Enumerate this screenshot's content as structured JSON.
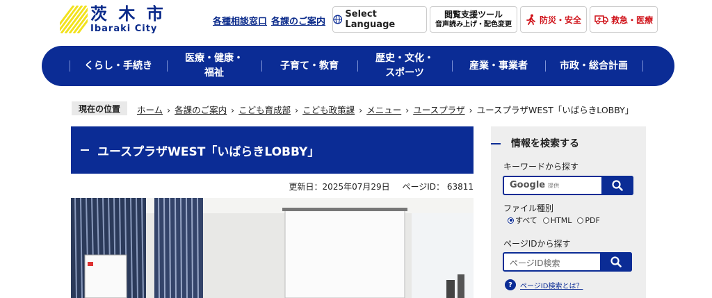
{
  "header": {
    "logo": {
      "jp": "茨 木 市",
      "en": "Ibaraki City"
    },
    "links": [
      {
        "label": "各種相談窓口"
      },
      {
        "label": "各課のご案内"
      }
    ],
    "language_button": "Select Language",
    "accessibility": {
      "title": "閲覧支援ツール",
      "subtitle": "音声読み上げ・配色変更"
    },
    "disaster_button": "防災・安全",
    "emergency_button": "救急・医療"
  },
  "nav": {
    "items": [
      {
        "label": "くらし・手続き"
      },
      {
        "label": "医療・健康・\n福祉"
      },
      {
        "label": "子育て・教育"
      },
      {
        "label": "歴史・文化・\nスポーツ"
      },
      {
        "label": "産業・事業者"
      },
      {
        "label": "市政・総合計画"
      }
    ]
  },
  "breadcrumb": {
    "label": "現在の位置",
    "items": [
      {
        "label": "ホーム"
      },
      {
        "label": "各課のご案内"
      },
      {
        "label": "こども育成部"
      },
      {
        "label": "こども政策課"
      },
      {
        "label": "メニュー"
      },
      {
        "label": "ユースプラザ"
      }
    ],
    "current": "ユースプラザWEST「いばらきLOBBY」"
  },
  "page": {
    "title": "ユースプラザWEST「いばらきLOBBY」",
    "updated": "更新日：2025年07月29日",
    "page_id": "ページID： 63811"
  },
  "sidebar": {
    "title": "情報を検索する",
    "keyword_label": "キーワードから探す",
    "google_label": "Google",
    "google_sub": "提供",
    "file_type_label": "ファイル種別",
    "file_types": [
      {
        "label": "すべて",
        "selected": true
      },
      {
        "label": "HTML",
        "selected": false
      },
      {
        "label": "PDF",
        "selected": false
      }
    ],
    "page_id_label": "ページIDから探す",
    "page_id_placeholder": "ページID検索",
    "help_text": "ページID検索とは？"
  },
  "colors": {
    "brand": "#0b2c95",
    "alert": "#d0151c",
    "logo_yellow": "#f2e21d"
  }
}
